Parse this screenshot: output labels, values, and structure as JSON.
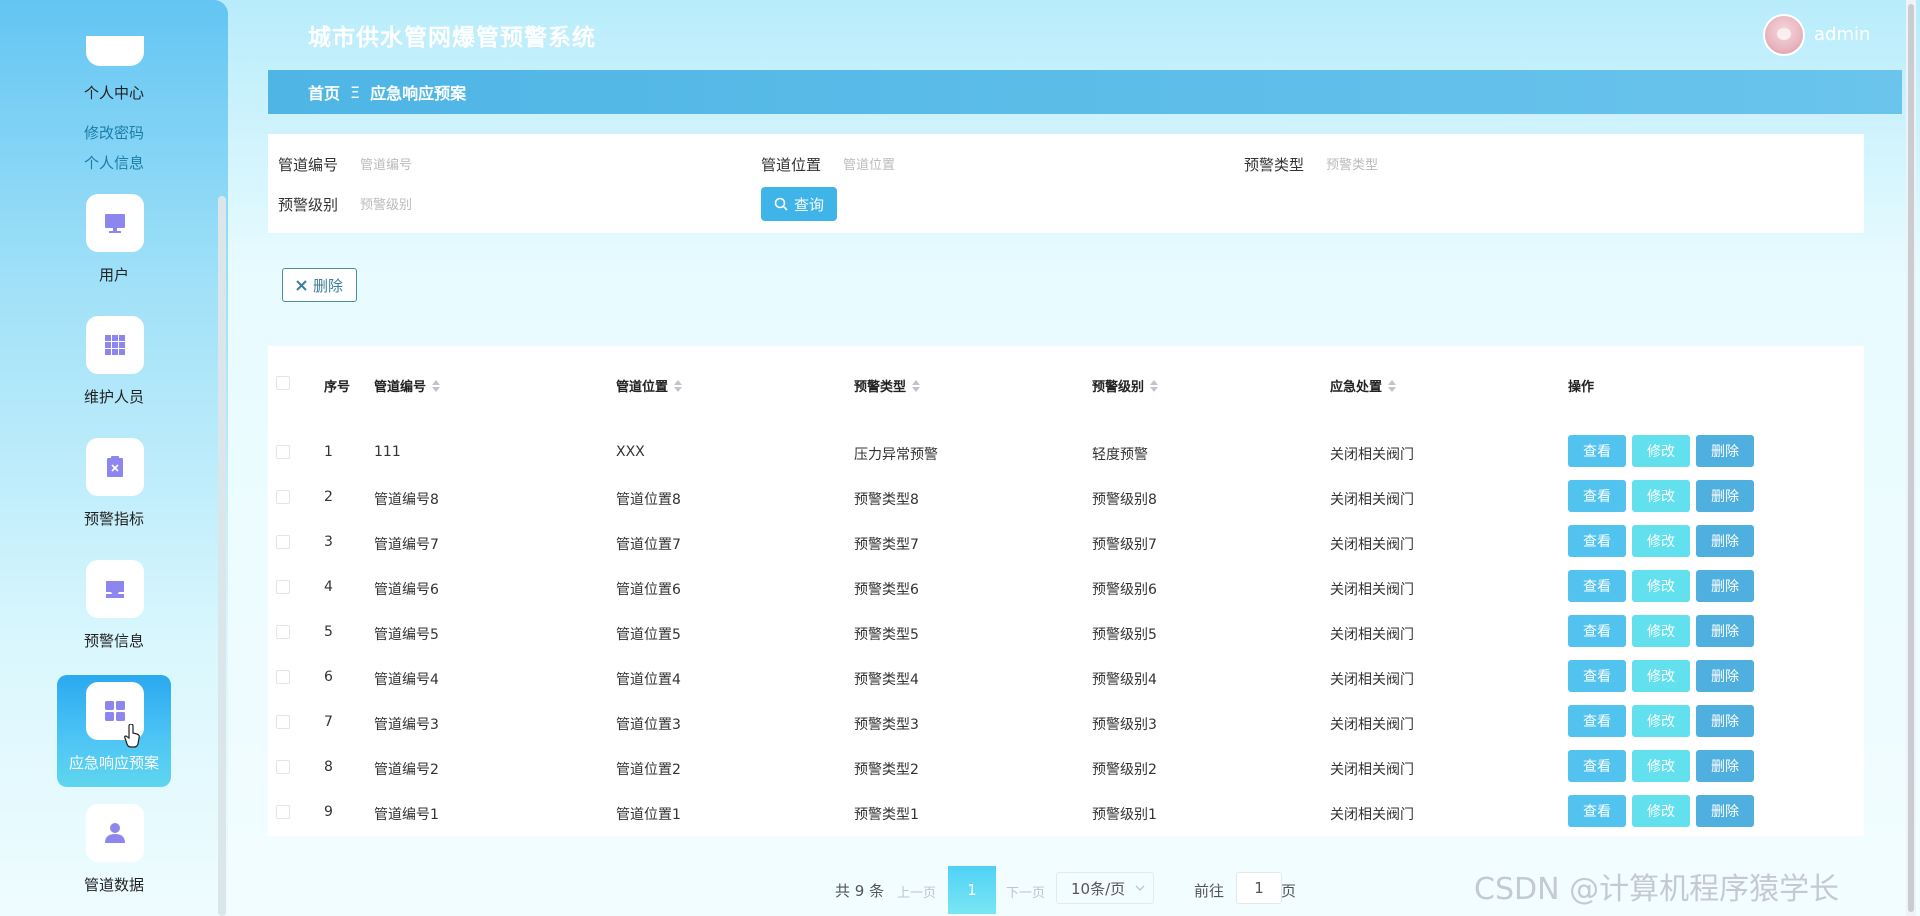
{
  "header": {
    "title": "城市供水管网爆管预警系统",
    "user": "admin"
  },
  "breadcrumb": {
    "home": "首页",
    "separator": "Ξ",
    "current": "应急响应预案"
  },
  "sidebar": {
    "profile_label": "个人中心",
    "profile_links": [
      "修改密码",
      "个人信息"
    ],
    "items": [
      {
        "label": "用户",
        "icon": "monitor-icon"
      },
      {
        "label": "维护人员",
        "icon": "grid-icon"
      },
      {
        "label": "预警指标",
        "icon": "clipboard-icon"
      },
      {
        "label": "预警信息",
        "icon": "inbox-icon"
      },
      {
        "label": "应急响应预案",
        "icon": "apps-icon",
        "active": true
      },
      {
        "label": "管道数据",
        "icon": "user-icon"
      }
    ]
  },
  "search": {
    "fields": [
      {
        "label": "管道编号",
        "placeholder": "管道编号"
      },
      {
        "label": "管道位置",
        "placeholder": "管道位置"
      },
      {
        "label": "预警类型",
        "placeholder": "预警类型"
      },
      {
        "label": "预警级别",
        "placeholder": "预警级别"
      }
    ],
    "button": "查询"
  },
  "toolbar": {
    "delete_label": "删除"
  },
  "table": {
    "columns": [
      "序号",
      "管道编号",
      "管道位置",
      "预警类型",
      "预警级别",
      "应急处置",
      "操作"
    ],
    "rows": [
      [
        "1",
        "111",
        "XXX",
        "压力异常预警",
        "轻度预警",
        "关闭相关阀门"
      ],
      [
        "2",
        "管道编号8",
        "管道位置8",
        "预警类型8",
        "预警级别8",
        "关闭相关阀门"
      ],
      [
        "3",
        "管道编号7",
        "管道位置7",
        "预警类型7",
        "预警级别7",
        "关闭相关阀门"
      ],
      [
        "4",
        "管道编号6",
        "管道位置6",
        "预警类型6",
        "预警级别6",
        "关闭相关阀门"
      ],
      [
        "5",
        "管道编号5",
        "管道位置5",
        "预警类型5",
        "预警级别5",
        "关闭相关阀门"
      ],
      [
        "6",
        "管道编号4",
        "管道位置4",
        "预警类型4",
        "预警级别4",
        "关闭相关阀门"
      ],
      [
        "7",
        "管道编号3",
        "管道位置3",
        "预警类型3",
        "预警级别3",
        "关闭相关阀门"
      ],
      [
        "8",
        "管道编号2",
        "管道位置2",
        "预警类型2",
        "预警级别2",
        "关闭相关阀门"
      ],
      [
        "9",
        "管道编号1",
        "管道位置1",
        "预警类型1",
        "预警级别1",
        "关闭相关阀门"
      ]
    ],
    "actions": {
      "view": "查看",
      "edit": "修改",
      "delete": "删除"
    }
  },
  "pagination": {
    "total": "共 9 条",
    "prev": "上一页",
    "current_page": "1",
    "next": "下一页",
    "page_size": "10条/页",
    "goto_prefix": "前往",
    "goto_value": "1",
    "goto_suffix": "页"
  },
  "watermark": "CSDN @计算机程序猿学长",
  "colors": {
    "accent": "#3fb4e8",
    "view": "#52c2ee",
    "edit": "#62e0ee",
    "delete": "#4fb0e0"
  }
}
